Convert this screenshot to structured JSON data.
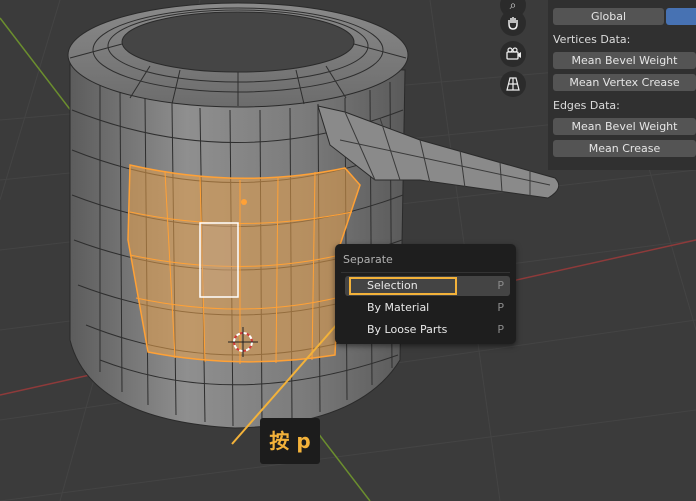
{
  "panel": {
    "orientation_button": "Global",
    "vertices_label": "Vertices Data:",
    "mean_bevel_weight_v": "Mean Bevel Weight",
    "mean_vertex_crease": "Mean Vertex Crease",
    "edges_label": "Edges Data:",
    "mean_bevel_weight_e": "Mean Bevel Weight",
    "mean_crease": "Mean Crease"
  },
  "menu": {
    "title": "Separate",
    "items": [
      {
        "label": "Selection",
        "key": "P"
      },
      {
        "label": "By Material",
        "key": "P"
      },
      {
        "label": "By Loose Parts",
        "key": "P"
      }
    ]
  },
  "callout": {
    "text": "按 p"
  },
  "colors": {
    "accent": "#f3b23a",
    "selection": "#e8a14b",
    "blue_toggle": "#4772b3"
  },
  "icons": [
    "hand-pan-icon",
    "camera-icon",
    "grid-perspective-icon"
  ]
}
